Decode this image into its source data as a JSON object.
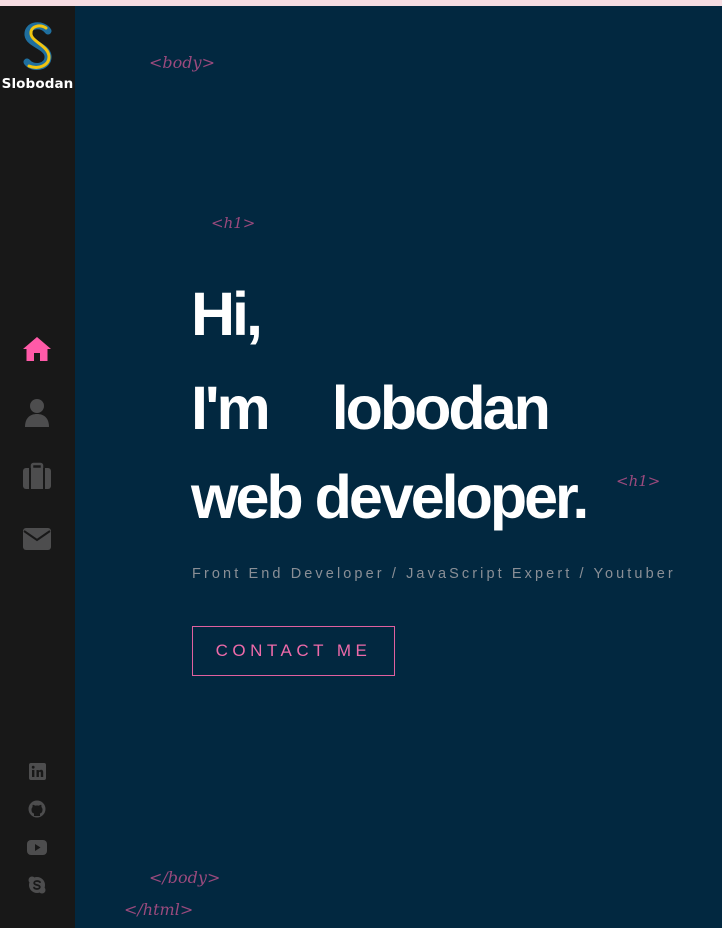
{
  "brand": {
    "logo_letter": "S",
    "name": "Slobodan"
  },
  "nav": {
    "items": [
      {
        "icon": "home-icon",
        "label": "Home",
        "active": true
      },
      {
        "icon": "user-icon",
        "label": "About"
      },
      {
        "icon": "briefcase-icon",
        "label": "Portfolio"
      },
      {
        "icon": "envelope-icon",
        "label": "Contact"
      }
    ]
  },
  "social": [
    {
      "icon": "linkedin-icon"
    },
    {
      "icon": "github-icon"
    },
    {
      "icon": "youtube-icon"
    },
    {
      "icon": "skype-icon"
    }
  ],
  "tags": {
    "body_open": "<body>",
    "h1_open": "<h1>",
    "h1_close": "<h1>",
    "body_close": "</body>",
    "html_close": "</html>"
  },
  "hero": {
    "line1": "Hi,",
    "line2_a": "I'm",
    "line2_b": "lobodan",
    "line3": "web developer."
  },
  "subtitle": "Front End Developer / JavaScript Expert / Youtuber",
  "cta": {
    "label": "CONTACT ME"
  },
  "colors": {
    "background": "#022840",
    "sidebar": "#181818",
    "accent": "#ff69b4",
    "tag": "#9b4a7d",
    "icon_inactive": "#4d4d4e"
  }
}
